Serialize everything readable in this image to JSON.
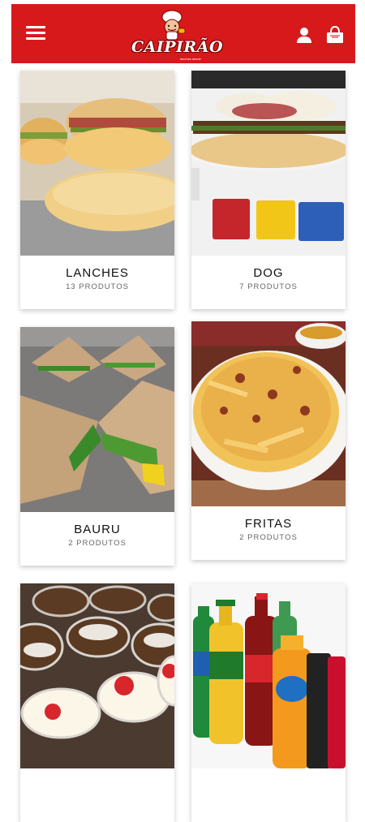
{
  "header": {
    "brand": "CAIPIRÃO",
    "brand_sub": "lanches desde",
    "color": "#d7191c",
    "icons": [
      "menu-icon",
      "user-icon",
      "shopping-bag-icon"
    ]
  },
  "categories": [
    {
      "name": "LANCHES",
      "count": "13 PRODUTOS"
    },
    {
      "name": "DOG",
      "count": "7 PRODUTOS"
    },
    {
      "name": "BAURU",
      "count": "2 PRODUTOS"
    },
    {
      "name": "FRITAS",
      "count": "2 PRODUTOS"
    },
    {
      "name": "",
      "count": ""
    },
    {
      "name": "",
      "count": ""
    }
  ]
}
